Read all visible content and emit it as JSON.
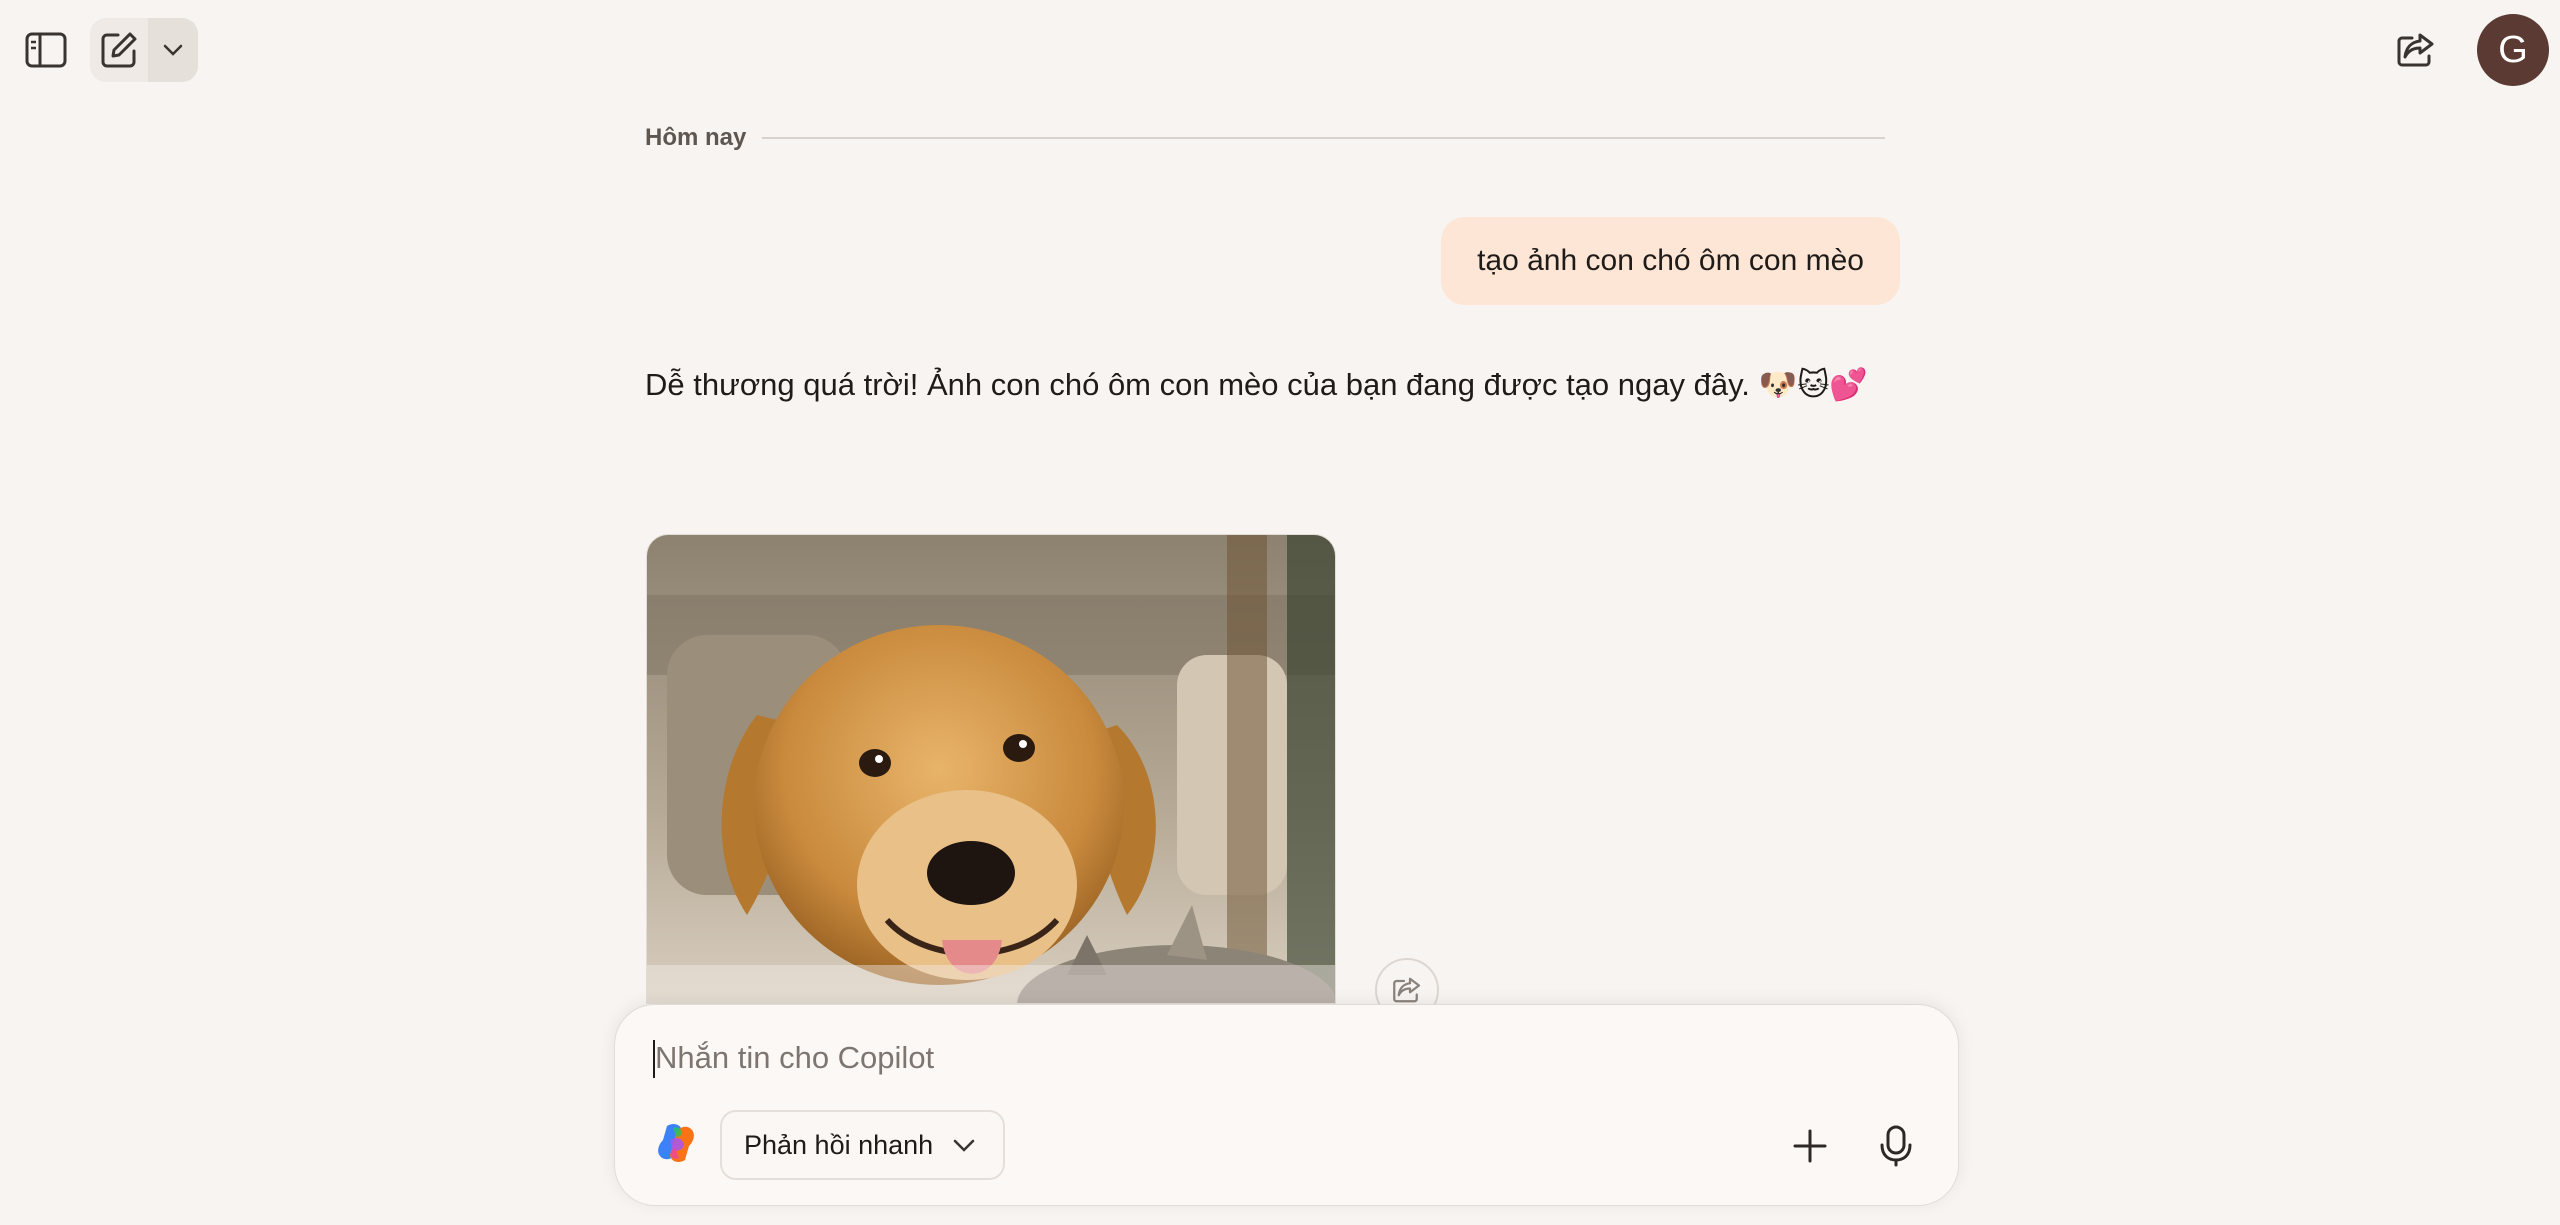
{
  "header": {
    "sidebar_toggle_icon": "sidebar-icon",
    "new_chat_icon": "compose-icon",
    "dropdown_icon": "chevron-down-icon",
    "share_icon": "share-icon",
    "avatar_initial": "G",
    "avatar_color": "#5b3a33"
  },
  "conversation": {
    "date_label": "Hôm nay",
    "user_message": "tạo ảnh con chó ôm con mèo",
    "assistant_message": "Dễ thương quá trời! Ảnh con chó ôm con mèo của bạn đang được tạo ngay đây. 🐶🐱💕",
    "image_share_icon": "share-icon"
  },
  "composer": {
    "placeholder": "Nhắn tin cho Copilot",
    "value": "",
    "mode_label": "Phản hồi nhanh",
    "add_icon": "plus-icon",
    "mic_icon": "microphone-icon"
  },
  "colors": {
    "background": "#f8f4f1",
    "user_bubble": "#fde6d6"
  }
}
